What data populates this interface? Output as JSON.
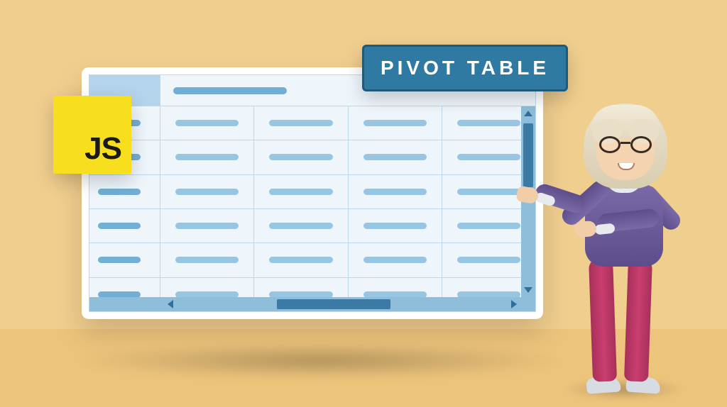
{
  "title_badge": "PIVOT TABLE",
  "js_badge": "JS",
  "table": {
    "columns": 4,
    "rows": 6
  }
}
